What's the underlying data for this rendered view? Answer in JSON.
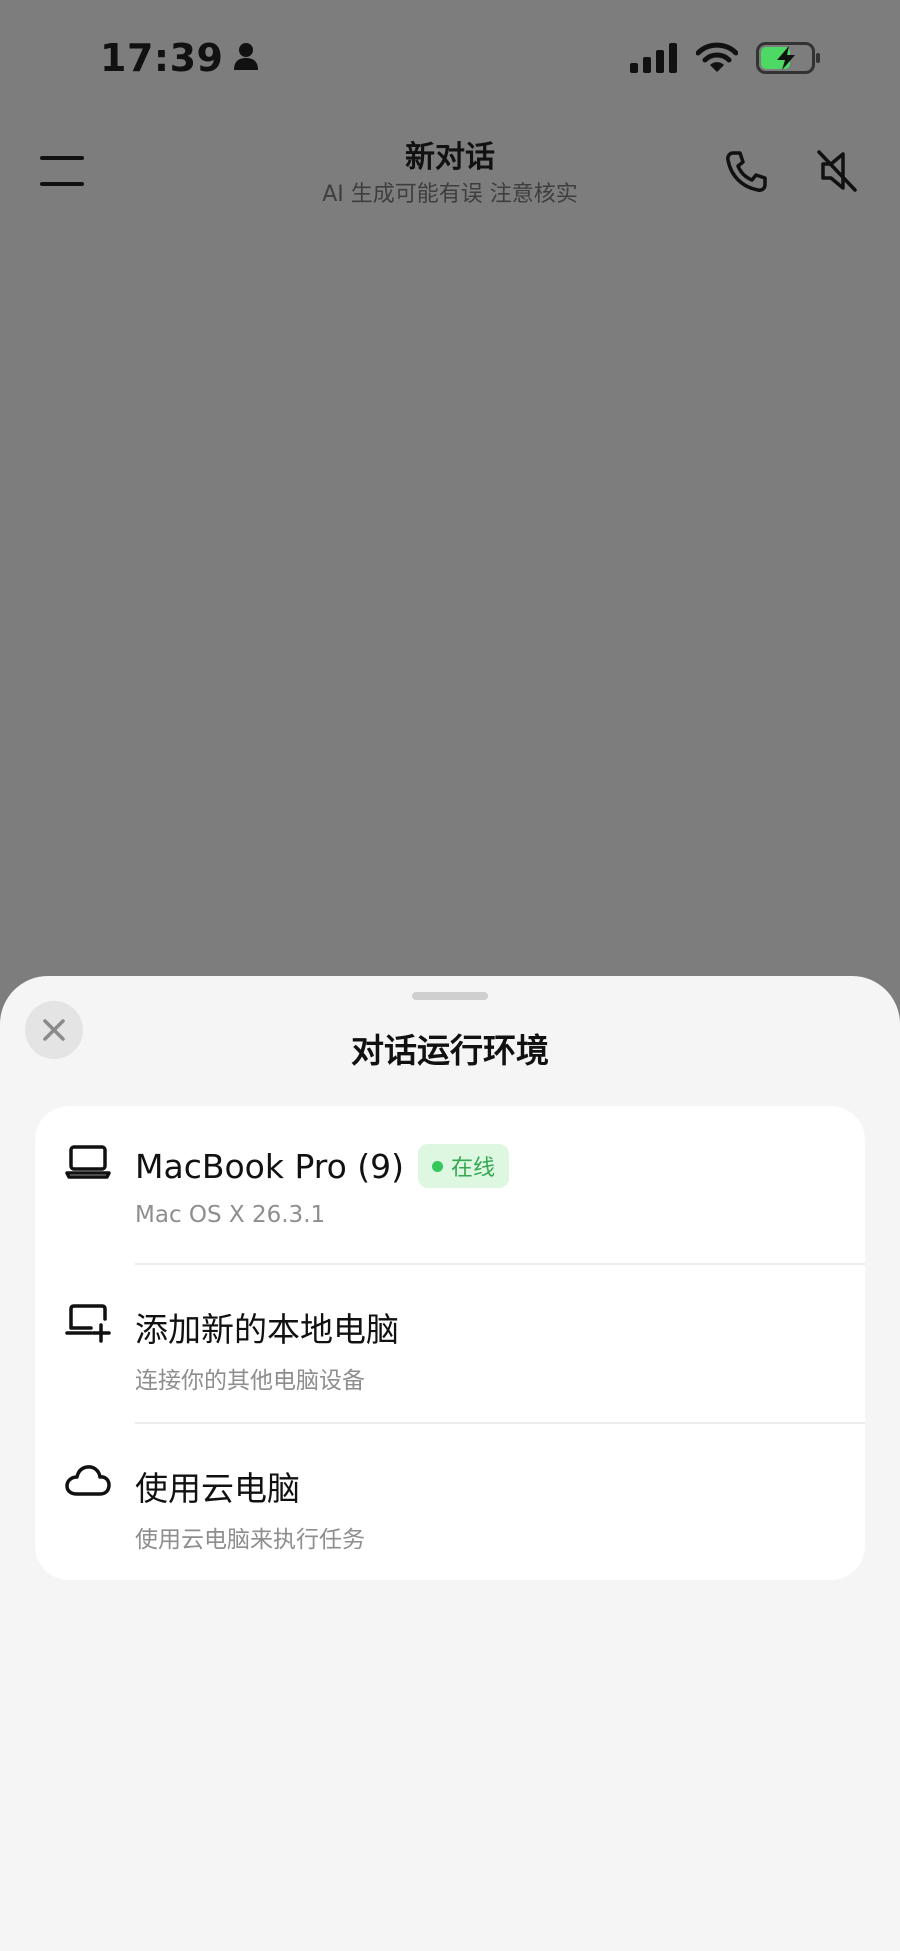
{
  "status_bar": {
    "time": "17:39",
    "icons": [
      "person-icon",
      "cellular-signal-icon",
      "wifi-icon",
      "battery-charging-icon"
    ]
  },
  "header": {
    "title": "新对话",
    "subtitle": "AI 生成可能有误 注意核实",
    "icons": [
      "menu-icon",
      "phone-icon",
      "speaker-muted-icon"
    ]
  },
  "sheet": {
    "title": "对话运行环境",
    "close_icon": "close-icon",
    "items": [
      {
        "icon": "laptop-icon",
        "title": "MacBook Pro (9)",
        "subtitle": "Mac OS X 26.3.1",
        "badge": "在线",
        "badge_color": "#34c759"
      },
      {
        "icon": "add-computer-icon",
        "title": "添加新的本地电脑",
        "subtitle": "连接你的其他电脑设备"
      },
      {
        "icon": "cloud-icon",
        "title": "使用云电脑",
        "subtitle": "使用云电脑来执行任务"
      }
    ]
  },
  "colors": {
    "backdrop": "#7d7d7d",
    "sheet_background": "#f5f5f5",
    "card_background": "#ffffff",
    "online_green": "#34c759"
  }
}
